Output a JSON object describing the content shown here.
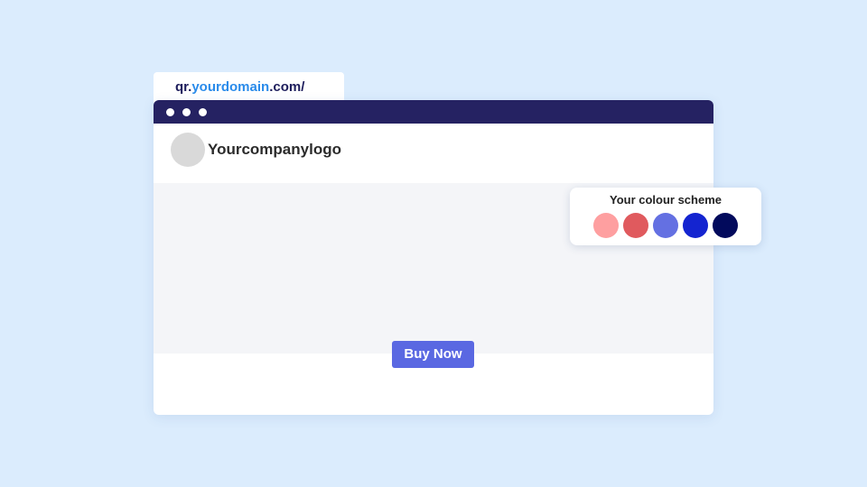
{
  "address_bar": {
    "prefix": "qr.",
    "domain": "yourdomain",
    "suffix": ".com/"
  },
  "page": {
    "logo_text": "Yourcompanylogo",
    "buy_button_label": "Buy Now"
  },
  "colour_scheme": {
    "title": "Your colour scheme",
    "swatches": [
      "#fe9fa0",
      "#e05a5e",
      "#6470e2",
      "#1424d0",
      "#020a5c"
    ]
  },
  "colors": {
    "background": "#dbecfd",
    "titlebar": "#252262",
    "url_domain_accent": "#2a8bea",
    "button": "#5a68e2",
    "hero": "#f4f5f8"
  }
}
